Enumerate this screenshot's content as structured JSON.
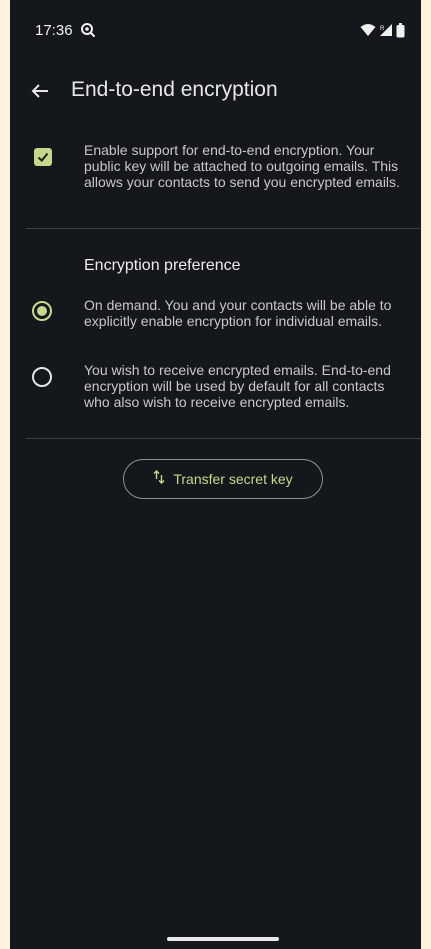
{
  "status_bar": {
    "time": "17:36",
    "notification_icon": "search-scan-icon",
    "right_icons": [
      "wifi-icon",
      "signal-icon",
      "battery-icon"
    ]
  },
  "app_bar": {
    "back_icon": "arrow-back-icon",
    "title": "End-to-end encryption"
  },
  "enable_pref": {
    "checked": true,
    "text": "Enable support for end-to-end encryption. Your public key will be attached to outgoing emails. This allows your contacts to send you encrypted emails."
  },
  "encryption_preference": {
    "header": "Encryption preference",
    "options": [
      {
        "selected": true,
        "text": "On demand. You and your contacts will be able to explicitly enable encryption for individual emails."
      },
      {
        "selected": false,
        "text": "You wish to receive encrypted emails. End-to-end encryption will be used by default for all contacts who also wish to receive encrypted emails."
      }
    ]
  },
  "transfer_button": {
    "icon": "swap-vert-icon",
    "label": "Transfer secret key"
  },
  "colors": {
    "background": "#14181d",
    "accent": "#c5d88c",
    "divider": "#3b3f44",
    "frame": "#fdf3dc"
  }
}
